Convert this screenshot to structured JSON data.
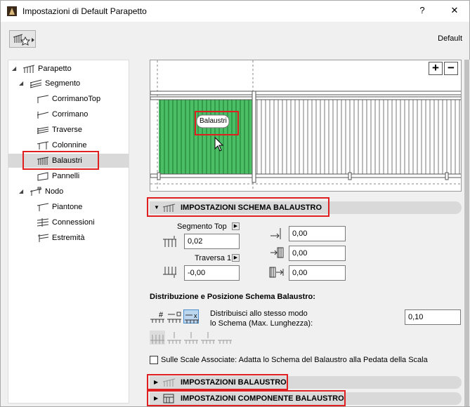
{
  "window": {
    "title": "Impostazioni di Default Parapetto",
    "help_glyph": "?",
    "close_glyph": "✕"
  },
  "toolbar": {
    "favorites_icon": "railing-star-icon",
    "preset_label": "Default"
  },
  "tree": {
    "items": [
      {
        "label": "Parapetto",
        "level": 0,
        "expanded": true,
        "icon": "railing-icon"
      },
      {
        "label": "Segmento",
        "level": 1,
        "expanded": true,
        "icon": "segment-icon"
      },
      {
        "label": "CorrimanoTop",
        "level": 2,
        "icon": "top-rail-icon"
      },
      {
        "label": "Corrimano",
        "level": 2,
        "icon": "handrail-icon"
      },
      {
        "label": "Traverse",
        "level": 2,
        "icon": "rail-icon"
      },
      {
        "label": "Colonnine",
        "level": 2,
        "icon": "post-icon"
      },
      {
        "label": "Balaustri",
        "level": 2,
        "icon": "baluster-icon",
        "selected": true
      },
      {
        "label": "Pannelli",
        "level": 2,
        "icon": "panel-icon"
      },
      {
        "label": "Nodo",
        "level": 1,
        "expanded": true,
        "icon": "node-icon"
      },
      {
        "label": "Piantone",
        "level": 2,
        "icon": "main-post-icon"
      },
      {
        "label": "Connessioni",
        "level": 2,
        "icon": "connection-icon"
      },
      {
        "label": "Estremità",
        "level": 2,
        "icon": "end-icon"
      }
    ]
  },
  "preview": {
    "tooltip": "Balaustri",
    "zoom_in": "+",
    "zoom_out": "−"
  },
  "sections": {
    "pattern": "IMPOSTAZIONI SCHEMA BALAUSTRO",
    "baluster": "IMPOSTAZIONI BALAUSTRO",
    "component": "IMPOSTAZIONI COMPONENTE BALAUSTRO"
  },
  "pattern_settings": {
    "segmento_top_label": "Segmento Top",
    "segmento_top_value": "0,02",
    "traversa_label": "Traversa 1",
    "traversa_value": "-0,00",
    "offset_right_value": "0,00",
    "offset_mid_value": "0,00",
    "offset_bottom_value": "0,00"
  },
  "distribution": {
    "heading": "Distribuzione e Posizione Schema Balaustro:",
    "description_line1": "Distribuisci allo stesso modo",
    "description_line2": "lo Schema (Max. Lunghezza):",
    "value": "0,10"
  },
  "stairs_option": {
    "label": "Sulle Scale Associate: Adatta lo Schema del Balaustro alla Pedata della Scala",
    "checked": false
  },
  "colors": {
    "highlight": "#e02020",
    "baluster_green": "#2db34a",
    "selected_bg": "#d9d9d9"
  }
}
